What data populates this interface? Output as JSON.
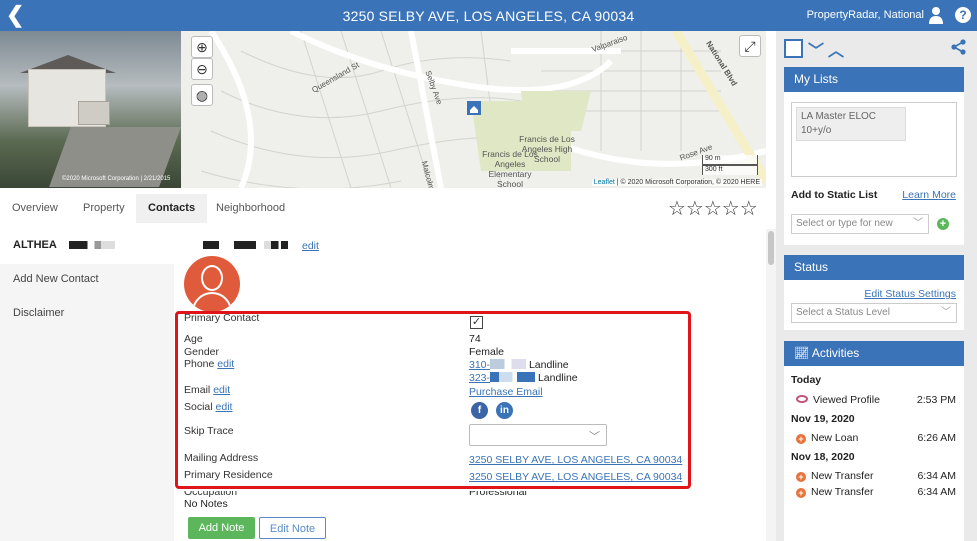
{
  "topbar": {
    "back_icon": "chevron-left-icon",
    "title": "3250 SELBY AVE, LOS ANGELES, CA 90034",
    "account": "PropertyRadar, National",
    "user_icon": "user-icon",
    "help": "?"
  },
  "photo": {
    "copyright": "©2020 Microsoft Corporation | 2/21/2015"
  },
  "map": {
    "streets": [
      "Queensland St",
      "Selby Ave",
      "Valparaiso",
      "National Blvd",
      "Rose Ave",
      "Malcolm"
    ],
    "poi": [
      "Francis de Los Angeles High School",
      "Francis de Los Angeles Elementary School"
    ],
    "scale_m": "90 m",
    "scale_ft": "300 ft",
    "attribution_leaflet": "Leaflet",
    "attribution_rest": " | © 2020 Microsoft Corporation, © 2020 HERE"
  },
  "tabs": [
    {
      "label": "Overview"
    },
    {
      "label": "Property"
    },
    {
      "label": "Contacts",
      "active": true
    },
    {
      "label": "Neighborhood"
    }
  ],
  "rating": {
    "stars": "☆☆☆☆☆",
    "value": 0,
    "max": 5
  },
  "leftnav": {
    "contact_name": "ALTHEA",
    "add_contact": "Add New Contact",
    "disclaimer": "Disclaimer"
  },
  "contact": {
    "edit_label": "edit",
    "fields": {
      "primary_contact": "Primary Contact",
      "age": "Age",
      "age_value": "74",
      "gender": "Gender",
      "gender_value": "Female",
      "phone": "Phone",
      "phone_edit": "edit",
      "phone1": "310-",
      "phone1_type": "Landline",
      "phone2": "323-",
      "phone2_type": "Landline",
      "email": "Email",
      "email_edit": "edit",
      "purchase_email": "Purchase Email",
      "social": "Social",
      "social_edit": "edit",
      "skip_trace": "Skip Trace",
      "mailing_address": "Mailing Address",
      "mailing_value": "3250 SELBY AVE, LOS ANGELES, CA 90034",
      "primary_residence": "Primary Residence",
      "residence_value": "3250 SELBY AVE, LOS ANGELES, CA 90034",
      "occupation": "Occupation",
      "occupation_value": "Professional",
      "notes": "No Notes"
    },
    "add_note": "Add Note",
    "edit_note": "Edit Note"
  },
  "right": {
    "my_lists": {
      "title": "My Lists",
      "tag": "LA Master ELOC 10+y/o",
      "add_static": "Add to Static List",
      "learn_more": "Learn More",
      "select_placeholder": "Select or type for new"
    },
    "status": {
      "title": "Status",
      "edit_settings": "Edit Status Settings",
      "select_placeholder": "Select a Status Level"
    },
    "activities": {
      "title": "Activities",
      "groups": [
        {
          "date": "Today",
          "items": [
            {
              "label": "Viewed Profile",
              "time": "2:53 PM"
            }
          ]
        },
        {
          "date": "Nov 19, 2020",
          "items": [
            {
              "label": "New Loan",
              "time": "6:26 AM"
            }
          ]
        },
        {
          "date": "Nov 18, 2020",
          "items": [
            {
              "label": "New Transfer",
              "time": "6:34 AM"
            },
            {
              "label": "New Transfer",
              "time": "6:34 AM"
            }
          ]
        }
      ]
    }
  }
}
